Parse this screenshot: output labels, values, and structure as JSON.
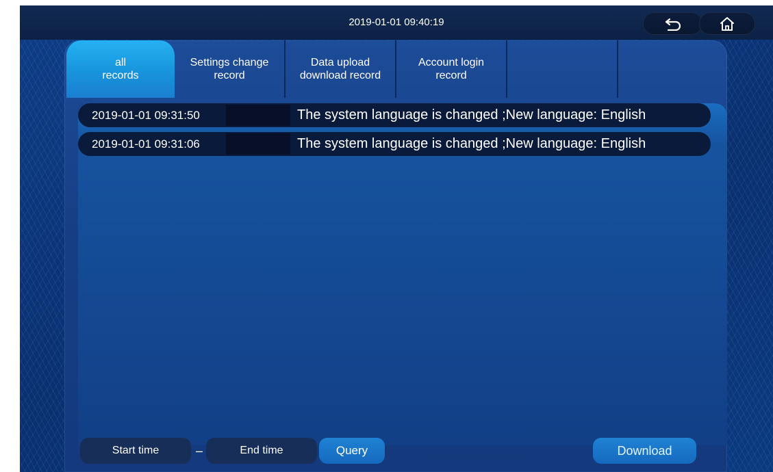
{
  "header": {
    "datetime": "2019-01-01 09:40:19",
    "back_icon": "back-arrow-icon",
    "home_icon": "home-icon"
  },
  "tabs": [
    {
      "line1": "all",
      "line2": "records",
      "active": true
    },
    {
      "line1": "Settings change",
      "line2": "record",
      "active": false
    },
    {
      "line1": "Data upload",
      "line2": "download record",
      "active": false
    },
    {
      "line1": "Account login",
      "line2": "record",
      "active": false
    },
    {
      "line1": "",
      "line2": "",
      "active": false
    },
    {
      "line1": "",
      "line2": "",
      "active": false
    }
  ],
  "records": [
    {
      "timestamp": "2019-01-01 09:31:50",
      "user": "",
      "message": "The system language is changed ;New language: English"
    },
    {
      "timestamp": "2019-01-01 09:31:06",
      "user": "",
      "message": "The system language is changed ;New language: English"
    }
  ],
  "filter": {
    "start_time": "Start time",
    "separator": "–",
    "end_time": "End time",
    "query_label": "Query"
  },
  "actions": {
    "download_label": "Download"
  },
  "colors": {
    "background": "#0b3473",
    "active_tab": "#1fa3e8",
    "row_bg": "#0a1a3b",
    "button": "#1a74c8"
  }
}
